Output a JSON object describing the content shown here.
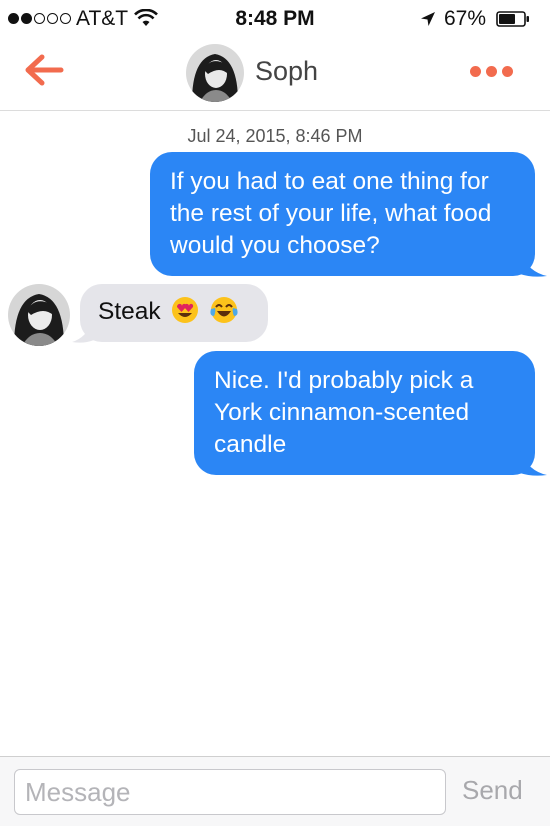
{
  "status_bar": {
    "carrier": "AT&T",
    "time": "8:48 PM",
    "battery_percent": "67%",
    "signal_bars_filled": 2,
    "signal_bars_total": 5,
    "battery_level": 0.67
  },
  "header": {
    "back_icon": "arrow-left-icon",
    "contact_name": "Soph",
    "more_icon": "more-dots-icon",
    "accent_color": "#f26b4e"
  },
  "conversation": {
    "timestamp": "Jul 24, 2015, 8:46 PM",
    "messages": [
      {
        "direction": "outgoing",
        "text": "If you had to eat one thing for the rest of your life, what food would you choose?"
      },
      {
        "direction": "incoming",
        "text": "Steak",
        "emojis": [
          "heart-eyes-emoji",
          "tears-of-joy-emoji"
        ]
      },
      {
        "direction": "outgoing",
        "text": "Nice. I'd probably pick a York cinnamon-scented candle"
      }
    ],
    "outgoing_color": "#2b86f5",
    "incoming_color": "#e5e5ea"
  },
  "composer": {
    "placeholder": "Message",
    "value": "",
    "send_label": "Send"
  }
}
